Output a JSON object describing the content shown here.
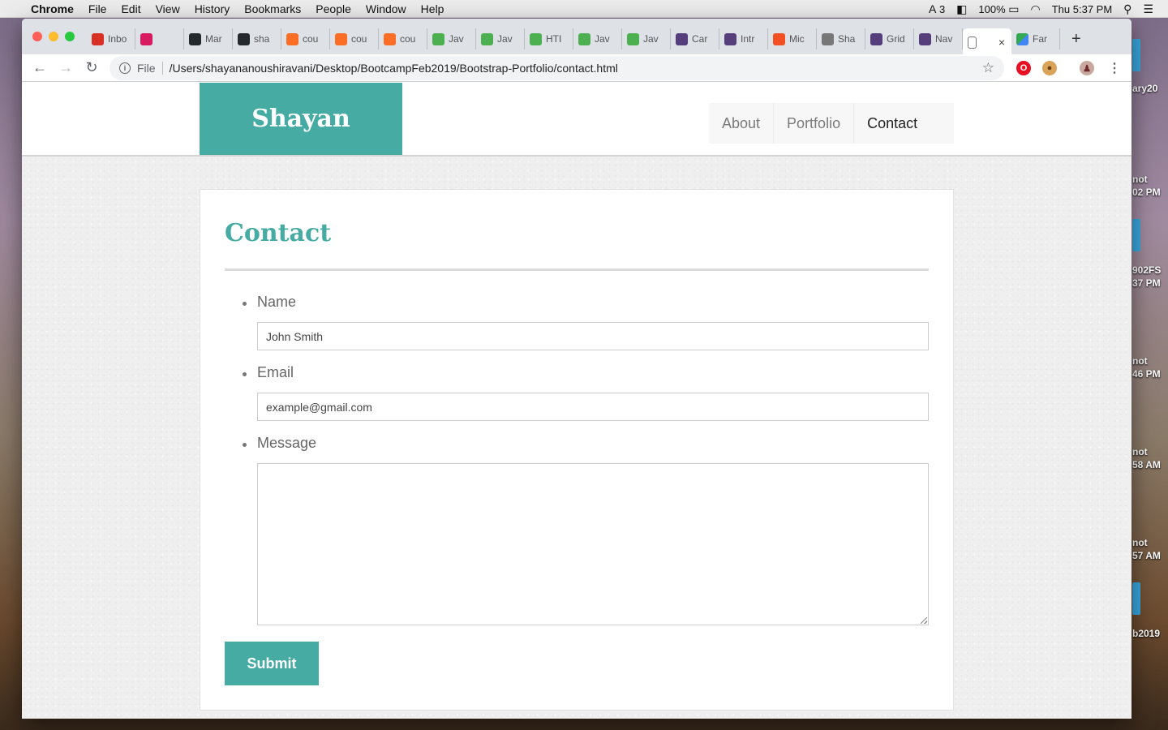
{
  "menubar": {
    "app": "Chrome",
    "items": [
      "File",
      "Edit",
      "View",
      "History",
      "Bookmarks",
      "People",
      "Window",
      "Help"
    ],
    "adobe_count": "3",
    "battery": "100%",
    "clock": "Thu 5:37 PM"
  },
  "desktop": {
    "labels": [
      "ary20",
      "not",
      "02 PM",
      "902FS",
      "37 PM",
      "not",
      "46 PM",
      "not",
      "58 AM",
      "not",
      "57 AM",
      "b2019"
    ]
  },
  "browser": {
    "tabs": [
      {
        "icon": "gmail-icon",
        "label": "Inbo",
        "color": "#d93025"
      },
      {
        "icon": "podcast-icon",
        "label": "",
        "color": "#d81b60"
      },
      {
        "icon": "github-icon",
        "label": "Mar",
        "color": "#24292e"
      },
      {
        "icon": "github-icon",
        "label": "sha",
        "color": "#24292e"
      },
      {
        "icon": "gitlab-icon",
        "label": "cou",
        "color": "#fc6d26"
      },
      {
        "icon": "gitlab-icon",
        "label": "cou",
        "color": "#fc6d26"
      },
      {
        "icon": "gitlab-icon",
        "label": "cou",
        "color": "#fc6d26"
      },
      {
        "icon": "w3schools-icon",
        "label": "Jav",
        "color": "#4caf50"
      },
      {
        "icon": "w3schools-icon",
        "label": "Jav",
        "color": "#4caf50"
      },
      {
        "icon": "w3schools-icon",
        "label": "HTI",
        "color": "#4caf50"
      },
      {
        "icon": "w3schools-icon",
        "label": "Jav",
        "color": "#4caf50"
      },
      {
        "icon": "w3schools-icon",
        "label": "Jav",
        "color": "#4caf50"
      },
      {
        "icon": "bootstrap-icon",
        "label": "Car",
        "color": "#563d7c"
      },
      {
        "icon": "bootstrap-icon",
        "label": "Intr",
        "color": "#563d7c"
      },
      {
        "icon": "microsoft-icon",
        "label": "Mic",
        "color": "#f25022"
      },
      {
        "icon": "document-icon",
        "label": "Sha",
        "color": "#777777"
      },
      {
        "icon": "bootstrap-icon",
        "label": "Grid",
        "color": "#563d7c"
      },
      {
        "icon": "bootstrap-icon",
        "label": "Nav",
        "color": "#563d7c"
      }
    ],
    "active_tab_close": "×",
    "after_tab": {
      "icon": "maps-icon",
      "label": "Far"
    },
    "new_tab": "+",
    "address": {
      "scheme": "File",
      "url": "/Users/shayananoushiravani/Desktop/BootcampFeb2019/Bootstrap-Portfolio/contact.html"
    }
  },
  "site": {
    "brand": "Shayan",
    "nav": [
      {
        "label": "About",
        "active": false
      },
      {
        "label": "Portfolio",
        "active": false
      },
      {
        "label": "Contact",
        "active": true
      }
    ],
    "accent": "#45aba3"
  },
  "contact": {
    "title": "Contact",
    "fields": {
      "name": {
        "label": "Name",
        "placeholder": "John Smith"
      },
      "email": {
        "label": "Email",
        "placeholder": "example@gmail.com"
      },
      "message": {
        "label": "Message",
        "value": ""
      }
    },
    "submit_label": "Submit"
  }
}
